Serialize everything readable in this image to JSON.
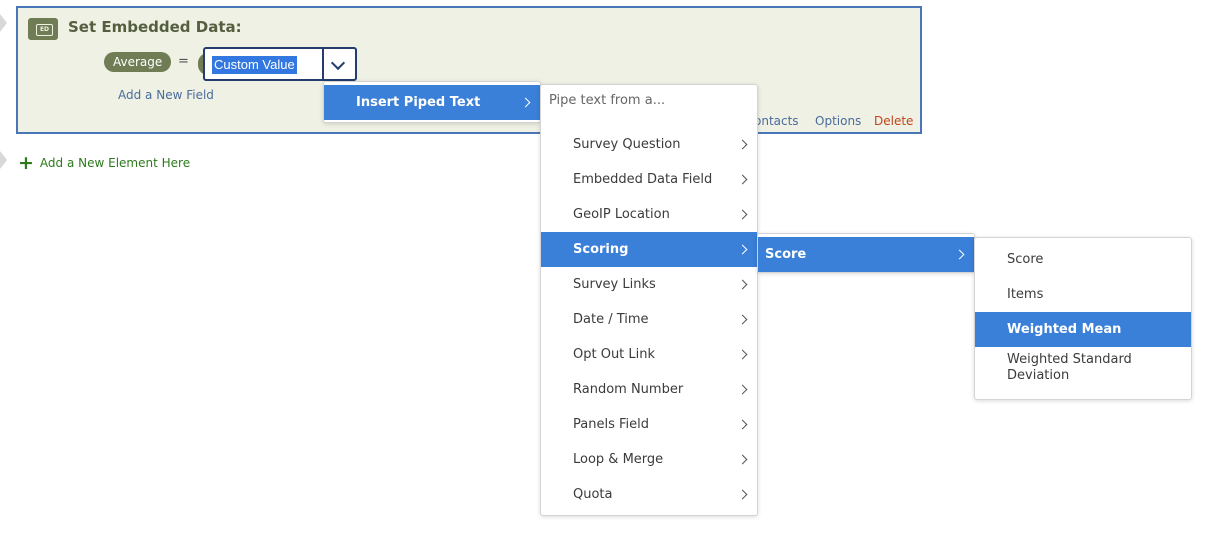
{
  "ed": {
    "badge": "ED",
    "title": "Set Embedded Data:",
    "field_name": "Average",
    "equals": "=",
    "value": "Custom Value",
    "add_field": "Add a New Field",
    "links": {
      "contacts": "ontacts",
      "options": "Options",
      "delete": "Delete"
    }
  },
  "add_element": {
    "plus": "+",
    "label": "Add a New Element Here"
  },
  "menus": {
    "insert_piped_text": "Insert Piped Text",
    "pipe_placeholder": "Pipe text from a...",
    "sources": [
      "Survey Question",
      "Embedded Data Field",
      "GeoIP Location",
      "Scoring",
      "Survey Links",
      "Date / Time",
      "Opt Out Link",
      "Random Number",
      "Panels Field",
      "Loop & Merge",
      "Quota"
    ],
    "active_source": "Scoring",
    "scoring_items": [
      "Score"
    ],
    "score_items": [
      "Score",
      "Items",
      "Weighted Mean",
      "Weighted Standard Deviation"
    ],
    "active_score_item": "Weighted Mean"
  },
  "colors": {
    "accent": "#3a7fd8",
    "ed_background": "#eef1e3",
    "ed_border": "#4a76b8",
    "badge": "#6f7c54",
    "delete": "#c0451c",
    "add_element": "#2d7a1d"
  }
}
